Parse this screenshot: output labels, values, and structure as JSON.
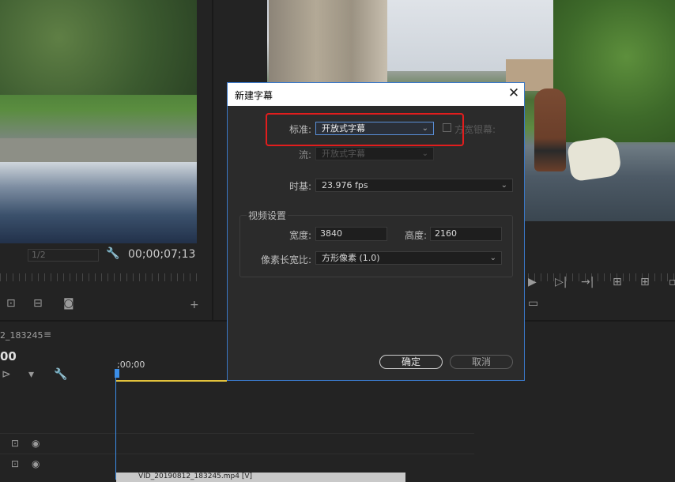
{
  "left_monitor": {
    "zoom": "1/2",
    "timecode": "00;00;07;13"
  },
  "timeline": {
    "sequence_name": "2_183245",
    "sequence_timecode": "00",
    "ruler_label": ";00;00",
    "clip_label": "VID_20190812_183245.mp4 [V]"
  },
  "dialog": {
    "title": "新建字幕",
    "close": "✕",
    "standard_label": "标准:",
    "standard_value": "开放式字幕",
    "widescreen_label": "方宽银幕:",
    "stream_label": "流:",
    "stream_value": "开放式字幕",
    "timebase_label": "时基:",
    "timebase_value": "23.976 fps",
    "video_settings_title": "视频设置",
    "width_label": "宽度:",
    "width_value": "3840",
    "height_label": "高度:",
    "height_value": "2160",
    "par_label": "像素长宽比:",
    "par_value": "方形像素 (1.0)",
    "ok_label": "确定",
    "cancel_label": "取消"
  },
  "colors": {
    "highlight": "#e21d1d",
    "dialog_border": "#3a78c8",
    "playhead": "#3b8ee8"
  }
}
